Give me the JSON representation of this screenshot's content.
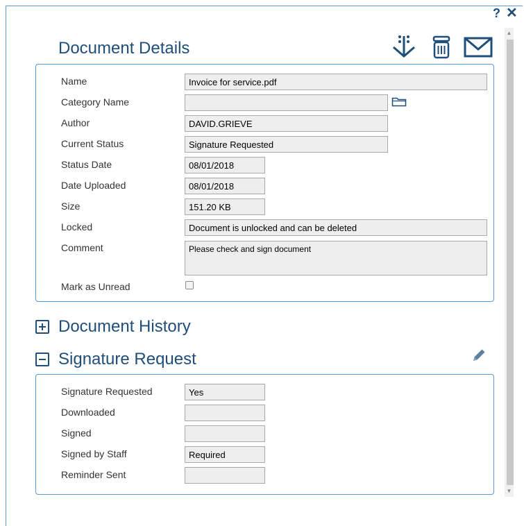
{
  "window": {
    "help_label": "?",
    "close_label": "✕"
  },
  "details": {
    "title": "Document Details",
    "toolbar": {
      "download_icon": "download-icon",
      "delete_icon": "trash-icon",
      "email_icon": "envelope-icon"
    },
    "fields": {
      "name": {
        "label": "Name",
        "value": "Invoice for service.pdf"
      },
      "category": {
        "label": "Category Name",
        "value": ""
      },
      "author": {
        "label": "Author",
        "value": "DAVID.GRIEVE"
      },
      "current_status": {
        "label": "Current Status",
        "value": "Signature Requested"
      },
      "status_date": {
        "label": "Status Date",
        "value": "08/01/2018"
      },
      "date_uploaded": {
        "label": "Date Uploaded",
        "value": "08/01/2018"
      },
      "size": {
        "label": "Size",
        "value": "151.20 KB"
      },
      "locked": {
        "label": "Locked",
        "value": "Document is unlocked and can be deleted"
      },
      "comment": {
        "label": "Comment",
        "value": "Please check and sign document"
      },
      "mark_unread": {
        "label": "Mark as Unread",
        "checked": false
      }
    }
  },
  "history": {
    "title": "Document History",
    "expanded": false
  },
  "signature": {
    "title": "Signature Request",
    "expanded": true,
    "edit_icon": "pencil-icon",
    "fields": {
      "requested": {
        "label": "Signature Requested",
        "value": "Yes"
      },
      "downloaded": {
        "label": "Downloaded",
        "value": ""
      },
      "signed": {
        "label": "Signed",
        "value": ""
      },
      "signed_by_staff": {
        "label": "Signed by Staff",
        "value": "Required"
      },
      "reminder_sent": {
        "label": "Reminder Sent",
        "value": ""
      }
    }
  },
  "colors": {
    "accent": "#1e4e79",
    "border": "#5b9bd5",
    "field_bg": "#eeeeee"
  }
}
